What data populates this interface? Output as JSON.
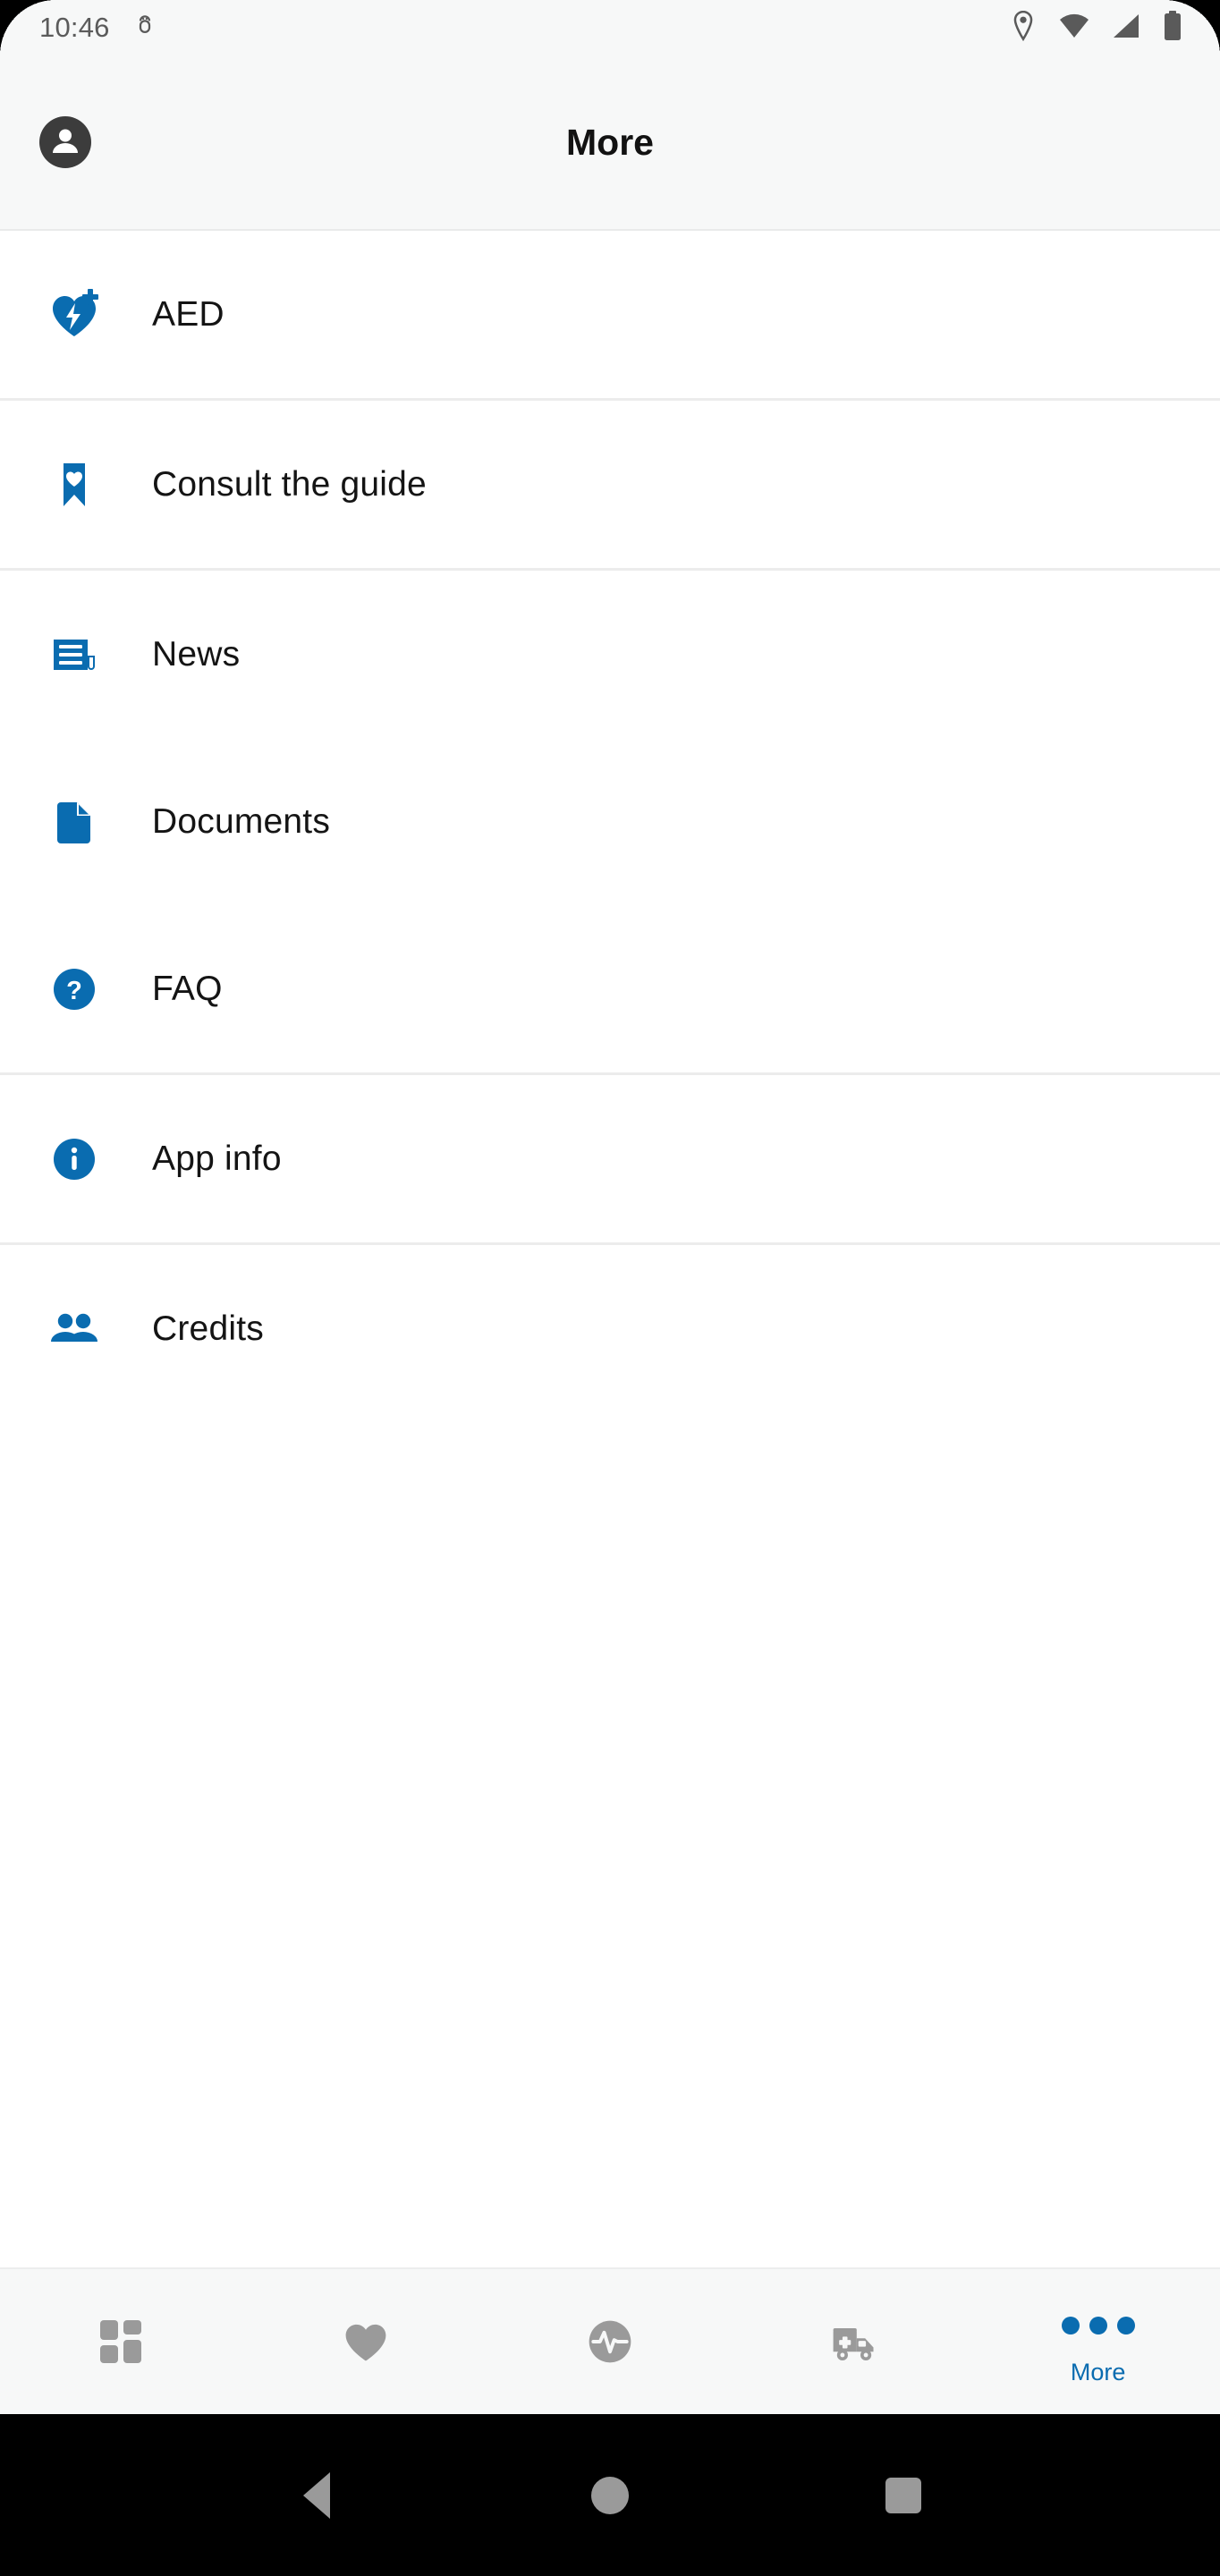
{
  "status_bar": {
    "time": "10:46",
    "left_icons": [
      "android-debug-icon"
    ],
    "right_icons": [
      "location-pin-icon",
      "wifi-icon",
      "cellular-signal-icon",
      "battery-icon"
    ]
  },
  "app_bar": {
    "title": "More",
    "avatar_icon": "account-circle-icon"
  },
  "colors": {
    "accent_blue": "#0a6cb0",
    "icon_gray": "#9a9a9a",
    "bar_background": "#f7f8f8",
    "divider": "#ececec",
    "text_primary": "#141414"
  },
  "menu_sections": [
    {
      "items": [
        {
          "label": "AED",
          "icon": "aed-heart-icon"
        }
      ]
    },
    {
      "items": [
        {
          "label": "Consult the guide",
          "icon": "bookmark-heart-icon"
        }
      ]
    },
    {
      "items": [
        {
          "label": "News",
          "icon": "newspaper-icon"
        },
        {
          "label": "Documents",
          "icon": "document-icon"
        },
        {
          "label": "FAQ",
          "icon": "help-circle-icon"
        }
      ]
    },
    {
      "items": [
        {
          "label": "App info",
          "icon": "info-circle-icon"
        }
      ]
    },
    {
      "items": [
        {
          "label": "Credits",
          "icon": "people-icon"
        }
      ]
    }
  ],
  "bottom_nav": {
    "items": [
      {
        "label": "",
        "icon": "dashboard-grid-icon",
        "active": false
      },
      {
        "label": "",
        "icon": "heart-icon",
        "active": false
      },
      {
        "label": "",
        "icon": "pulse-circle-icon",
        "active": false
      },
      {
        "label": "",
        "icon": "ambulance-icon",
        "active": false
      },
      {
        "label": "More",
        "icon": "more-dots-icon",
        "active": true
      }
    ]
  },
  "system_nav": {
    "back": "back-triangle-icon",
    "home": "home-circle-icon",
    "recents": "recents-square-icon"
  }
}
